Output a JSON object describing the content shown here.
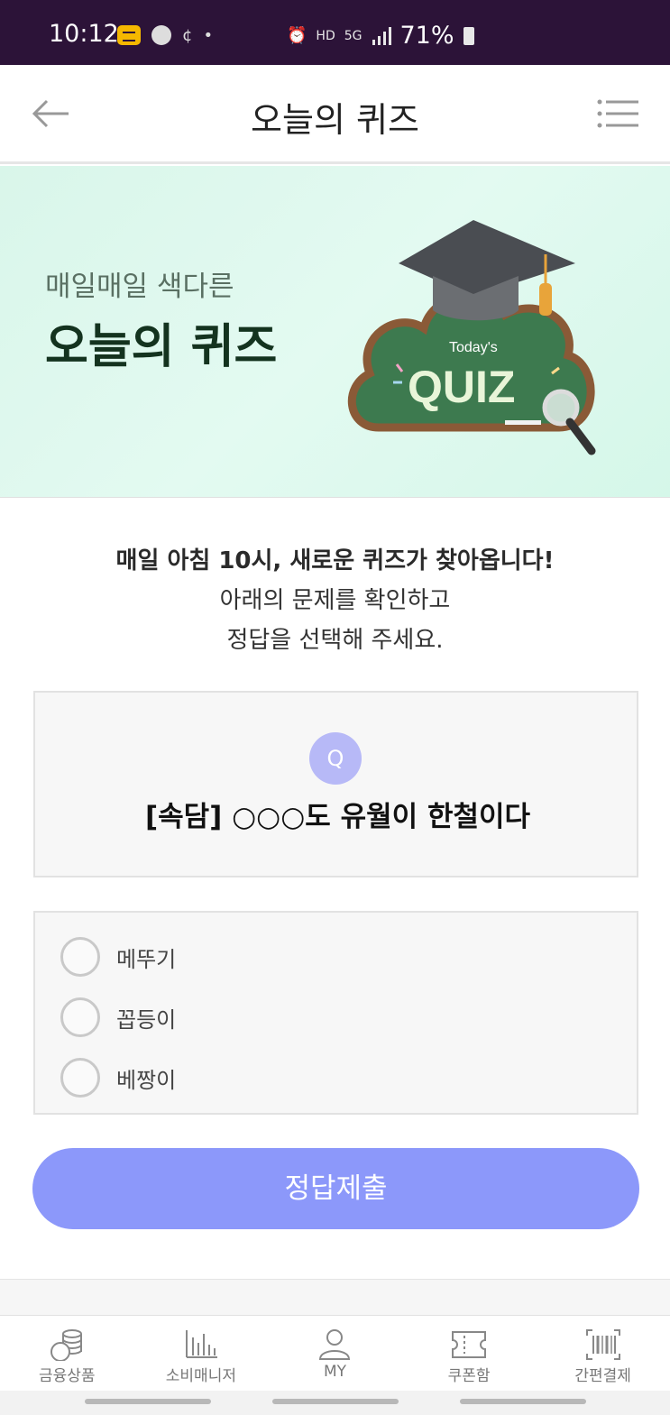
{
  "status_bar": {
    "time": "10:12",
    "network": "HD",
    "network_sub": "5G",
    "battery": "71%"
  },
  "header": {
    "title": "오늘의 퀴즈"
  },
  "banner": {
    "subtitle": "매일매일 색다른",
    "title": "오늘의 퀴즈",
    "art_small": "Today's",
    "art_big": "QUIZ"
  },
  "intro": {
    "line1": "매일 아침 10시, 새로운 퀴즈가 찾아옵니다!",
    "line2": "아래의 문제를 확인하고",
    "line3": "정답을 선택해 주세요."
  },
  "question": {
    "badge": "Q",
    "text": "[속담] ○○○도 유월이 한철이다"
  },
  "options": [
    {
      "label": "메뚜기",
      "selected": false
    },
    {
      "label": "꼽등이",
      "selected": false
    },
    {
      "label": "베짱이",
      "selected": false
    }
  ],
  "submit": {
    "label": "정답제출"
  },
  "bottom_nav": {
    "items": [
      {
        "label": "금융상품",
        "icon": "coins-icon"
      },
      {
        "label": "소비매니저",
        "icon": "bar-chart-icon"
      },
      {
        "label": "MY",
        "icon": "person-icon"
      },
      {
        "label": "쿠폰함",
        "icon": "ticket-icon"
      },
      {
        "label": "간편결제",
        "icon": "barcode-icon"
      }
    ]
  },
  "colors": {
    "status_bar": "#2c1338",
    "accent": "#8c98fa",
    "q_badge": "#b7b9f7",
    "banner_bg": "#dbf7ec"
  }
}
